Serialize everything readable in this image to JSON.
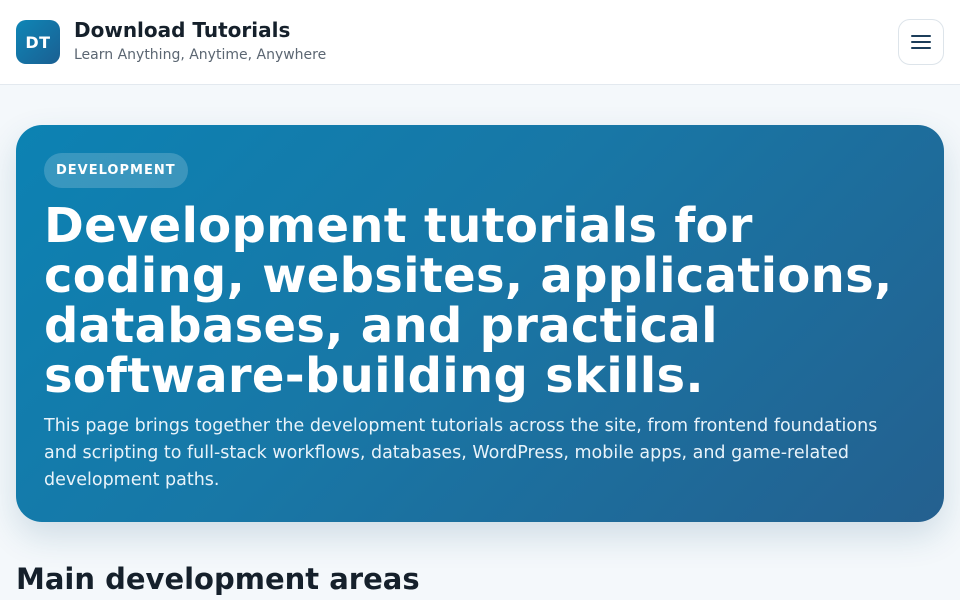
{
  "header": {
    "logo_text": "DT",
    "site_title": "Download Tutorials",
    "tagline": "Learn Anything, Anytime, Anywhere",
    "menu_icon": "hamburger-menu-icon"
  },
  "hero": {
    "badge": "DEVELOPMENT",
    "title": "Development tutorials for coding, websites, applications, databases, and practical software-building skills.",
    "description": "This page brings together the development tutorials across the site, from frontend foundations and scripting to full-stack workflows, databases, WordPress, mobile apps, and game-related development paths."
  },
  "main": {
    "section_heading": "Main development areas"
  },
  "colors": {
    "accent": "#0f86b6",
    "accent_dark": "#24608f",
    "page_background": "#f4f8fb",
    "text": "#15202b"
  }
}
